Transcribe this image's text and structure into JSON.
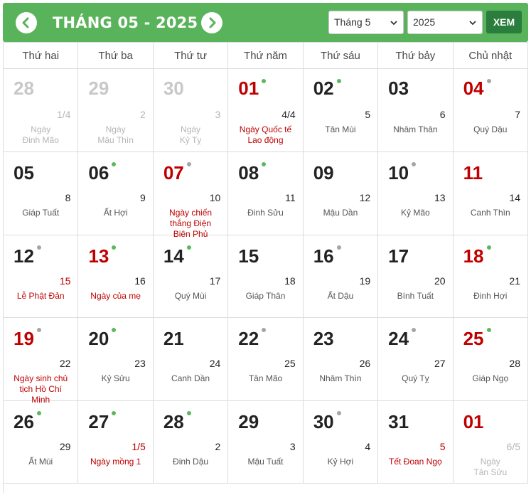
{
  "header": {
    "title": "THÁNG 05 - 2025",
    "month_select": "Tháng 5",
    "year_select": "2025",
    "go_label": "XEM",
    "accent_color": "#58b35a",
    "button_color": "#2a7d3c"
  },
  "weekdays": [
    "Thứ hai",
    "Thứ ba",
    "Thứ tư",
    "Thứ năm",
    "Thứ sáu",
    "Thứ bảy",
    "Chủ nhật"
  ],
  "days": [
    {
      "day": "28",
      "lunar": "1/4",
      "info": "Ngày\nĐinh Mão",
      "out": true
    },
    {
      "day": "29",
      "lunar": "2",
      "info": "Ngày\nMậu Thìn",
      "out": true
    },
    {
      "day": "30",
      "lunar": "3",
      "info": "Ngày\nKỷ Tỵ",
      "out": true
    },
    {
      "day": "01",
      "lunar": "4/4",
      "event": "Ngày Quốc tế\nLao động",
      "holiday": true,
      "dot": "green"
    },
    {
      "day": "02",
      "lunar": "5",
      "info": "Tân Mùi",
      "dot": "green"
    },
    {
      "day": "03",
      "lunar": "6",
      "info": "Nhâm Thân"
    },
    {
      "day": "04",
      "lunar": "7",
      "info": "Quý Dậu",
      "holiday": true,
      "dot": "gray"
    },
    {
      "day": "05",
      "lunar": "8",
      "info": "Giáp Tuất"
    },
    {
      "day": "06",
      "lunar": "9",
      "info": "Ất Hợi",
      "dot": "green"
    },
    {
      "day": "07",
      "lunar": "10",
      "event": "Ngày chiến\nthắng Điện\nBiên Phủ",
      "holiday": true,
      "dot": "gray"
    },
    {
      "day": "08",
      "lunar": "11",
      "info": "Đinh Sửu",
      "dot": "green"
    },
    {
      "day": "09",
      "lunar": "12",
      "info": "Mậu Dần"
    },
    {
      "day": "10",
      "lunar": "13",
      "info": "Kỷ Mão",
      "dot": "gray"
    },
    {
      "day": "11",
      "lunar": "14",
      "info": "Canh Thìn",
      "holiday": true
    },
    {
      "day": "12",
      "lunar": "15",
      "event": "Lễ Phật Đản",
      "dot": "gray",
      "lunar_red": true
    },
    {
      "day": "13",
      "lunar": "16",
      "event": "Ngày của mẹ",
      "holiday": true,
      "dot": "green"
    },
    {
      "day": "14",
      "lunar": "17",
      "info": "Quý Mùi",
      "dot": "green"
    },
    {
      "day": "15",
      "lunar": "18",
      "info": "Giáp Thân"
    },
    {
      "day": "16",
      "lunar": "19",
      "info": "Ất Dậu",
      "dot": "gray"
    },
    {
      "day": "17",
      "lunar": "20",
      "info": "Bính Tuất"
    },
    {
      "day": "18",
      "lunar": "21",
      "info": "Đinh Hợi",
      "holiday": true,
      "dot": "green"
    },
    {
      "day": "19",
      "lunar": "22",
      "event": "Ngày sinh chủ\ntịch Hồ Chí\nMinh",
      "holiday": true,
      "dot": "gray"
    },
    {
      "day": "20",
      "lunar": "23",
      "info": "Kỷ Sửu",
      "dot": "green"
    },
    {
      "day": "21",
      "lunar": "24",
      "info": "Canh Dần"
    },
    {
      "day": "22",
      "lunar": "25",
      "info": "Tân Mão",
      "dot": "gray"
    },
    {
      "day": "23",
      "lunar": "26",
      "info": "Nhâm Thìn"
    },
    {
      "day": "24",
      "lunar": "27",
      "info": "Quý Tỵ",
      "dot": "gray"
    },
    {
      "day": "25",
      "lunar": "28",
      "info": "Giáp Ngọ",
      "holiday": true,
      "dot": "green"
    },
    {
      "day": "26",
      "lunar": "29",
      "info": "Ất Mùi",
      "dot": "green"
    },
    {
      "day": "27",
      "lunar": "1/5",
      "event": "Ngày mồng 1",
      "dot": "green",
      "lunar_red": true
    },
    {
      "day": "28",
      "lunar": "2",
      "info": "Đinh Dậu",
      "dot": "green"
    },
    {
      "day": "29",
      "lunar": "3",
      "info": "Mậu Tuất"
    },
    {
      "day": "30",
      "lunar": "4",
      "info": "Kỷ Hợi",
      "dot": "gray"
    },
    {
      "day": "31",
      "lunar": "5",
      "event": "Tết Đoan Ngọ",
      "lunar_red": true
    },
    {
      "day": "01",
      "lunar": "6/5",
      "info": "Ngày\nTân Sửu",
      "holiday": true,
      "out_lunar": true
    }
  ]
}
